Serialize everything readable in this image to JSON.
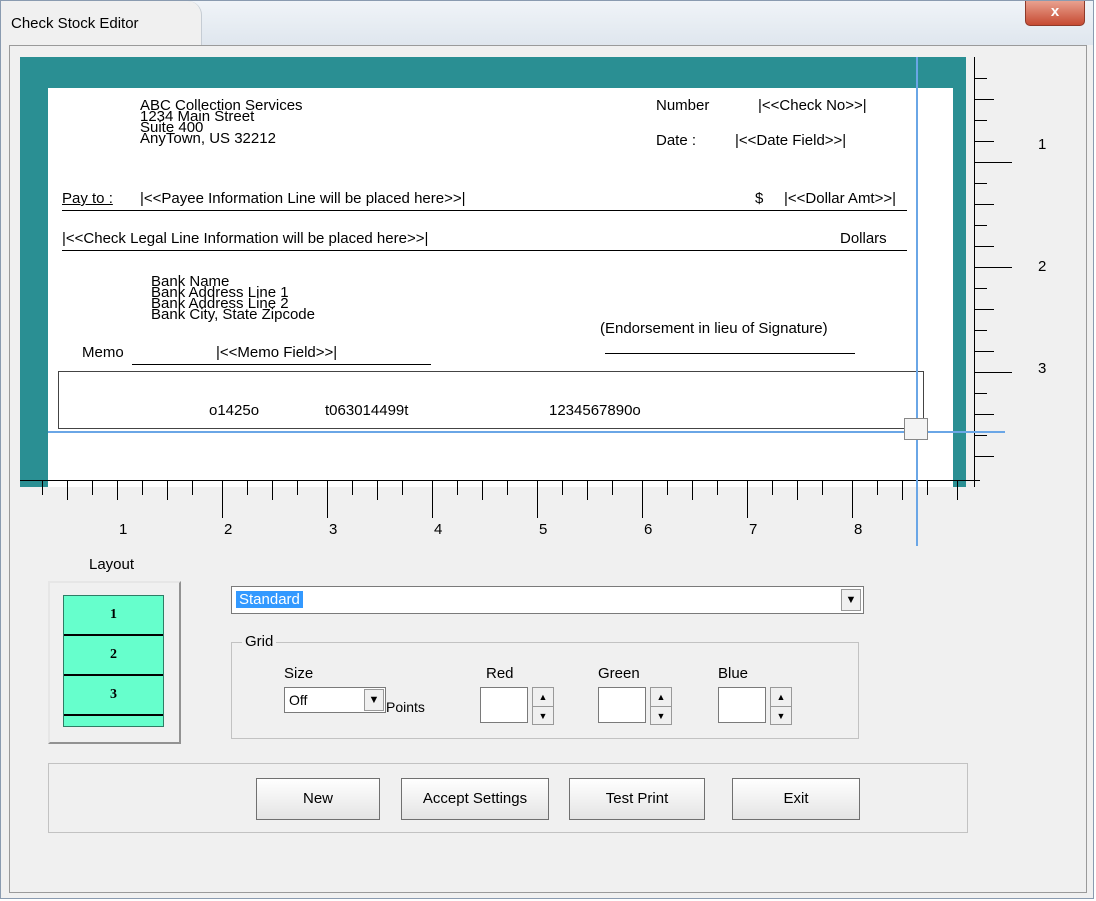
{
  "window": {
    "title": "Check Stock Editor",
    "close_glyph": "x"
  },
  "check": {
    "company_name": "ABC Collection Services",
    "address_line1": "1234 Main Street",
    "address_line2": "Suite 400",
    "address_line3": "AnyTown, US  32212",
    "number_label": "Number",
    "number_field": "|<<Check No>>|",
    "date_label": "Date :",
    "date_field": "|<<Date Field>>|",
    "pay_to_label": "Pay to :",
    "payee_field": "|<<Payee Information Line will be placed here>>|",
    "dollar_sign": "$",
    "dollar_field": "|<<Dollar Amt>>|",
    "legal_field": "|<<Check Legal Line Information will be placed here>>|",
    "dollars_label": "Dollars",
    "bank_name": "Bank Name",
    "bank_address1": "Bank Address Line 1",
    "bank_address2": "Bank Address Line 2",
    "bank_city": "Bank City, State  Zipcode",
    "endorsement": "(Endorsement in lieu of Signature)",
    "memo_label": "Memo",
    "memo_field": "|<<Memo Field>>|",
    "micr_check": "o1425o",
    "micr_routing": "t063014499t",
    "micr_account": "1234567890o"
  },
  "rulers": {
    "horizontal_labels": [
      "1",
      "2",
      "3",
      "4",
      "5",
      "6",
      "7",
      "8"
    ],
    "vertical_labels": [
      "1",
      "2",
      "3"
    ]
  },
  "layout": {
    "label": "Layout",
    "cells": [
      "1",
      "2",
      "3"
    ]
  },
  "template_select": {
    "value": "Standard",
    "arrow": "▼"
  },
  "grid": {
    "legend": "Grid",
    "size_label": "Size",
    "size_value": "Off",
    "points_label": "Points",
    "red_label": "Red",
    "green_label": "Green",
    "blue_label": "Blue",
    "spin_up": "▲",
    "spin_down": "▼"
  },
  "buttons": {
    "new": "New",
    "accept": "Accept Settings",
    "test_print": "Test Print",
    "exit": "Exit"
  }
}
